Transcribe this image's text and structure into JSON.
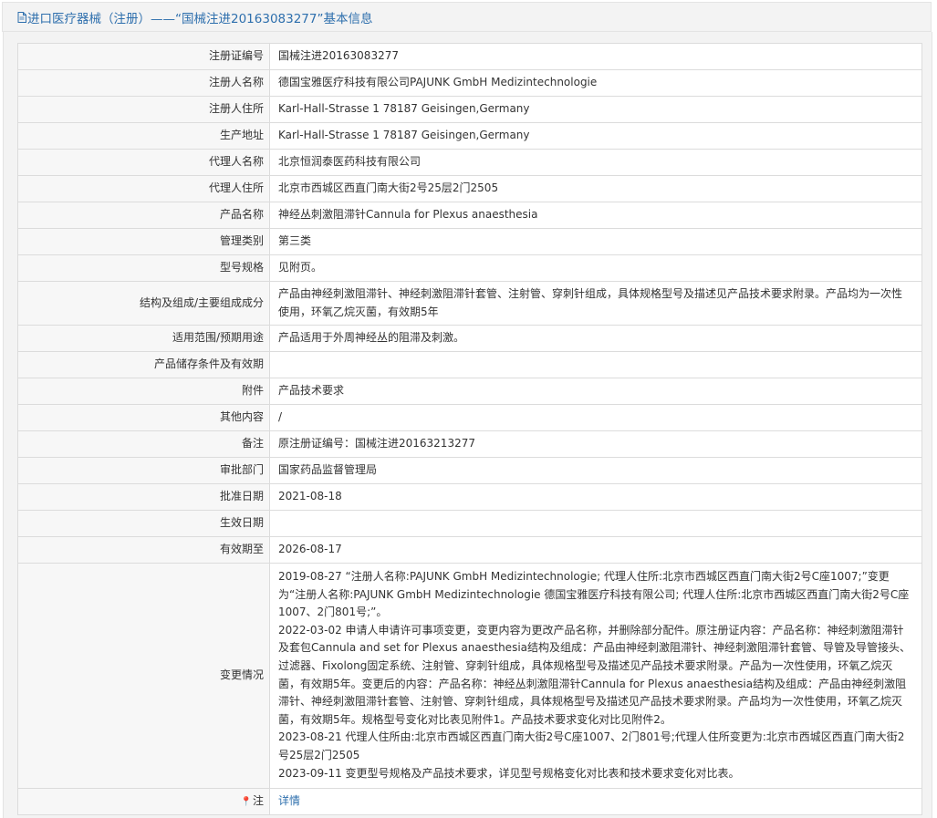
{
  "header": {
    "title": "进口医疗器械（注册）——“国械注进20163083277”基本信息",
    "icon": "document-icon"
  },
  "rows": [
    {
      "label": "注册证编号",
      "value": "国械注进20163083277"
    },
    {
      "label": "注册人名称",
      "value": "德国宝雅医疗科技有限公司PAJUNK GmbH Medizintechnologie"
    },
    {
      "label": "注册人住所",
      "value": "Karl-Hall-Strasse 1 78187 Geisingen,Germany"
    },
    {
      "label": "生产地址",
      "value": "Karl-Hall-Strasse 1 78187 Geisingen,Germany"
    },
    {
      "label": "代理人名称",
      "value": "北京恒润泰医药科技有限公司"
    },
    {
      "label": "代理人住所",
      "value": "北京市西城区西直门南大街2号25层2门2505"
    },
    {
      "label": "产品名称",
      "value": "神经丛刺激阻滞针Cannula for Plexus anaesthesia"
    },
    {
      "label": "管理类别",
      "value": "第三类"
    },
    {
      "label": "型号规格",
      "value": "见附页。"
    },
    {
      "label": "结构及组成/主要组成成分",
      "value": "产品由神经刺激阻滞针、神经刺激阻滞针套管、注射管、穿刺针组成，具体规格型号及描述见产品技术要求附录。产品均为一次性使用，环氧乙烷灭菌，有效期5年"
    },
    {
      "label": "适用范围/预期用途",
      "value": "产品适用于外周神经丛的阻滞及刺激。"
    },
    {
      "label": "产品储存条件及有效期",
      "value": ""
    },
    {
      "label": "附件",
      "value": "产品技术要求"
    },
    {
      "label": "其他内容",
      "value": "/"
    },
    {
      "label": "备注",
      "value": "原注册证编号：国械注进20163213277"
    },
    {
      "label": "审批部门",
      "value": "国家药品监督管理局"
    },
    {
      "label": "批准日期",
      "value": "2021-08-18"
    },
    {
      "label": "生效日期",
      "value": ""
    },
    {
      "label": "有效期至",
      "value": "2026-08-17"
    }
  ],
  "changes": {
    "label": "变更情况",
    "entries": [
      "2019-08-27 “注册人名称:PAJUNK GmbH Medizintechnologie; 代理人住所:北京市西城区西直门南大街2号C座1007;”变更为“注册人名称:PAJUNK GmbH Medizintechnologie 德国宝雅医疗科技有限公司; 代理人住所:北京市西城区西直门南大街2号C座1007、2门801号;”。",
      "2022-03-02 申请人申请许可事项变更，变更内容为更改产品名称，并删除部分配件。原注册证内容：产品名称：神经刺激阻滞针及套包Cannula and set for Plexus anaesthesia结构及组成：产品由神经刺激阻滞针、神经刺激阻滞针套管、导管及导管接头、过滤器、Fixolong固定系统、注射管、穿刺针组成，具体规格型号及描述见产品技术要求附录。产品为一次性使用，环氧乙烷灭菌，有效期5年。变更后的内容：产品名称：神经丛刺激阻滞针Cannula for Plexus anaesthesia结构及组成：产品由神经刺激阻滞针、神经刺激阻滞针套管、注射管、穿刺针组成，具体规格型号及描述见产品技术要求附录。产品均为一次性使用，环氧乙烷灭菌，有效期5年。规格型号变化对比表见附件1。产品技术要求变化对比见附件2。",
      "2023-08-21 代理人住所由:北京市西城区西直门南大街2号C座1007、2门801号;代理人住所变更为:北京市西城区西直门南大街2号25层2门2505",
      "2023-09-11 变更型号规格及产品技术要求，详见型号规格变化对比表和技术要求变化对比表。"
    ]
  },
  "note_row": {
    "label": "注",
    "icon": "pin-icon",
    "link_text": "详情"
  },
  "colors": {
    "title": "#2e6fad",
    "link": "#2e6fad",
    "label_bg": "#f7f7f7",
    "border": "#dcdcdc",
    "panel_bg": "#f3f3f3"
  }
}
